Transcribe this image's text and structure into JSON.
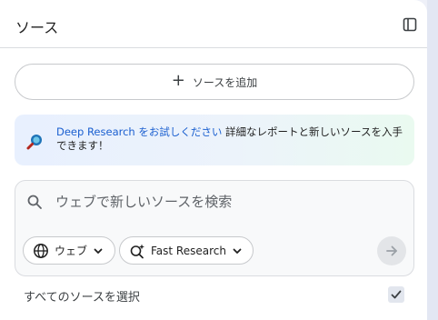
{
  "header": {
    "title": "ソース",
    "toggle_icon": "panel-toggle-icon"
  },
  "add_source": {
    "label": "ソースを追加",
    "icon": "plus-icon"
  },
  "promo": {
    "link_text": "Deep Research をお試しください",
    "body_text": " 詳細なレポートと新しいソースを入手できます！",
    "icon": "magnifier-sparkle-icon"
  },
  "search": {
    "placeholder": "ウェブで新しいソースを検索",
    "source_chip": {
      "label": "ウェブ",
      "icon": "globe-icon"
    },
    "mode_chip": {
      "label": "Fast Research",
      "icon": "sparkle-search-icon"
    },
    "submit_icon": "arrow-right-icon"
  },
  "select_all": {
    "label": "すべてのソースを選択",
    "checked": true
  },
  "colors": {
    "link": "#1a5fd0",
    "panel_bg": "#ffffff",
    "page_bg": "#eef0f8"
  }
}
